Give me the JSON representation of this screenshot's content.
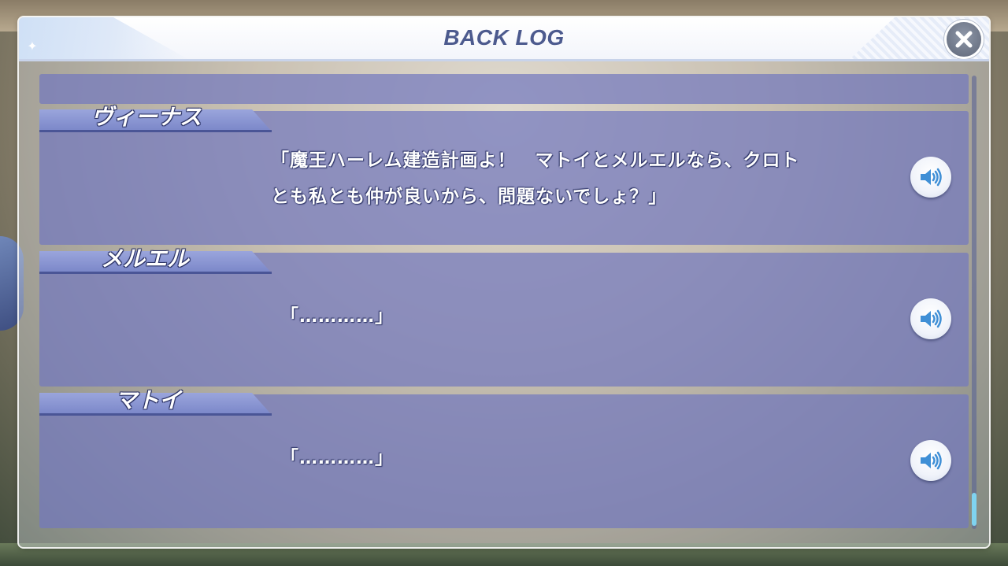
{
  "window": {
    "title": "BACK LOG"
  },
  "entries": [
    {
      "speaker": "ヴィーナス",
      "text_line1": "「魔王ハーレム建造計画よ！　マトイとメルエルなら、クロト",
      "text_line2": "とも私とも仲が良いから、問題ないでしょ？」",
      "voice_icon": "speaker-icon"
    },
    {
      "speaker": "メルエル",
      "text_line1": "「…………」",
      "voice_icon": "speaker-icon"
    },
    {
      "speaker": "マトイ",
      "text_line1": "「…………」",
      "voice_icon": "speaker-icon"
    }
  ],
  "scroll": {
    "position": 1.0
  },
  "colors": {
    "title": "#4c5a8e",
    "entry_bg": "#7378be",
    "scroll_thumb": "#7fd3f0"
  }
}
